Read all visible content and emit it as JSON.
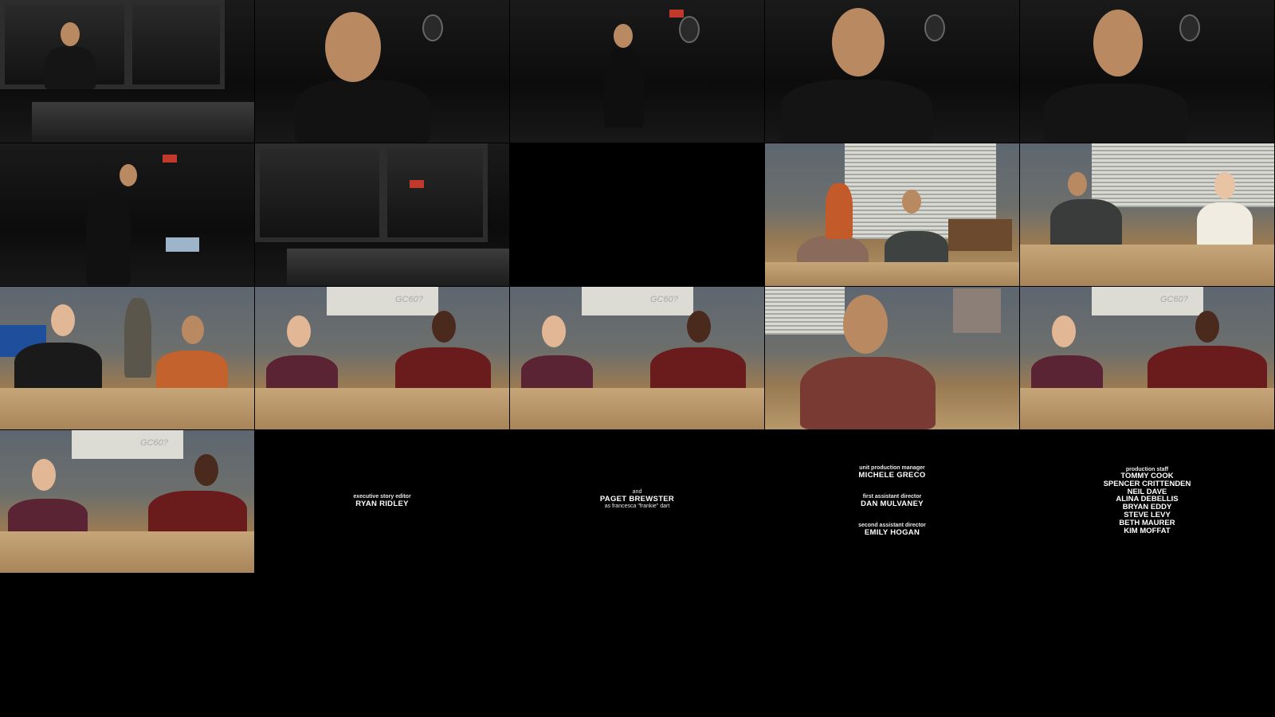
{
  "grid": {
    "columns": 5,
    "rows": 4,
    "tiles": [
      {
        "id": "r1c1",
        "scene": "recording-booth"
      },
      {
        "id": "r1c2",
        "scene": "recording-booth"
      },
      {
        "id": "r1c3",
        "scene": "recording-booth"
      },
      {
        "id": "r1c4",
        "scene": "recording-booth"
      },
      {
        "id": "r1c5",
        "scene": "recording-booth"
      },
      {
        "id": "r2c1",
        "scene": "recording-booth"
      },
      {
        "id": "r2c2",
        "scene": "recording-booth"
      },
      {
        "id": "r2c3",
        "scene": "black"
      },
      {
        "id": "r2c4",
        "scene": "study-room"
      },
      {
        "id": "r2c5",
        "scene": "study-room"
      },
      {
        "id": "r3c1",
        "scene": "study-room"
      },
      {
        "id": "r3c2",
        "scene": "study-room"
      },
      {
        "id": "r3c3",
        "scene": "study-room"
      },
      {
        "id": "r3c4",
        "scene": "study-room"
      },
      {
        "id": "r3c5",
        "scene": "study-room"
      },
      {
        "id": "r4c1",
        "scene": "study-room"
      },
      {
        "id": "r4c2",
        "scene": "credits"
      },
      {
        "id": "r4c3",
        "scene": "credits"
      },
      {
        "id": "r4c4",
        "scene": "credits"
      },
      {
        "id": "r4c5",
        "scene": "credits"
      }
    ]
  },
  "credits": {
    "editor": {
      "role": "executive story editor",
      "name": "RYAN RIDLEY"
    },
    "cast": {
      "lead": "and",
      "name": "PAGET BREWSTER",
      "character": "as francesca \"frankie\" dart"
    },
    "crew": [
      {
        "role": "unit production manager",
        "name": "MICHELE GRECO"
      },
      {
        "role": "first assistant director",
        "name": "DAN MULVANEY"
      },
      {
        "role": "second assistant director",
        "name": "EMILY HOGAN"
      }
    ],
    "staff": {
      "role": "production staff",
      "names": [
        "TOMMY COOK",
        "SPENCER CRITTENDEN",
        "NEIL DAVE",
        "ALINA DEBELLIS",
        "BRYAN EDDY",
        "STEVE LEVY",
        "BETH MAURER",
        "KIM MOFFAT"
      ]
    }
  },
  "sign_text": "GC60?",
  "colors": {
    "background": "#000000",
    "credit_text": "#ffffff"
  }
}
